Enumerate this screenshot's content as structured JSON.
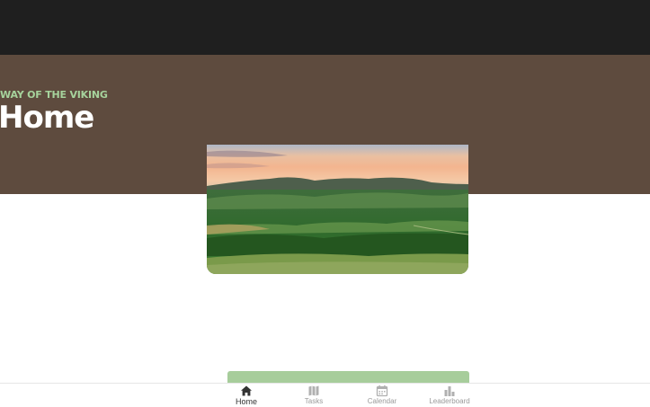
{
  "header": {
    "eyebrow": "WAY OF THE VIKING",
    "title": "Home"
  },
  "colors": {
    "top_bar": "#1f1f1f",
    "header_bg": "#5e4b3e",
    "accent_green": "#a6d39c",
    "tab_active": "#333333",
    "tab_inactive": "#9a9a9a"
  },
  "hero_image": {
    "subject": "green hills landscape at sunset"
  },
  "tabs": [
    {
      "label": "Home",
      "icon": "home-icon",
      "active": true
    },
    {
      "label": "Tasks",
      "icon": "map-icon",
      "active": false
    },
    {
      "label": "Calendar",
      "icon": "calendar-icon",
      "active": false
    },
    {
      "label": "Leaderboard",
      "icon": "bar-chart-icon",
      "active": false
    }
  ]
}
